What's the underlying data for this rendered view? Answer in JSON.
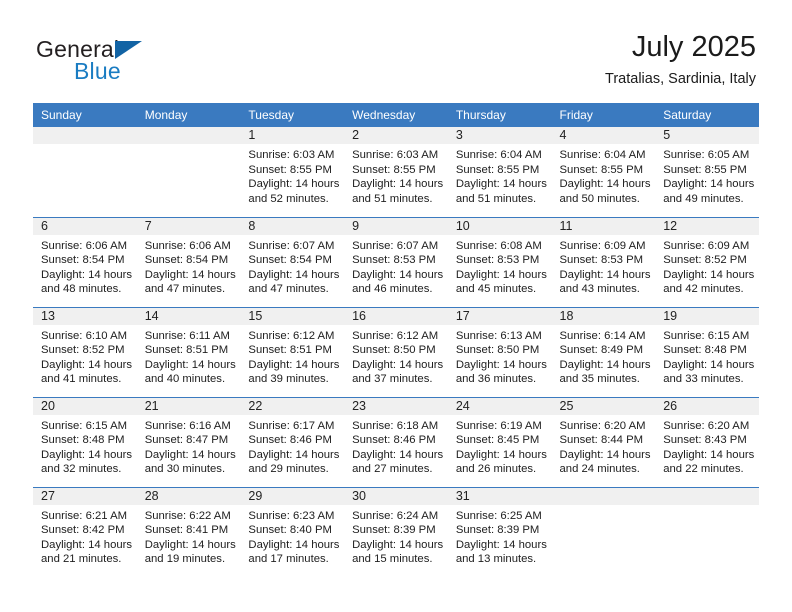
{
  "brand": {
    "name_part1": "General",
    "name_part2": "Blue",
    "logo_icon": "triangle-logo-icon"
  },
  "header": {
    "month_title": "July 2025",
    "location": "Tratalias, Sardinia, Italy"
  },
  "calendar": {
    "weekday_headers": [
      "Sunday",
      "Monday",
      "Tuesday",
      "Wednesday",
      "Thursday",
      "Friday",
      "Saturday"
    ],
    "colors": {
      "header_blue": "#3a7ac0",
      "daynum_band": "#f0f0f0",
      "brand_blue": "#1a7cc2",
      "logo_triangle": "#1263a4"
    },
    "weeks": [
      [
        {
          "day": "",
          "empty": true,
          "sunrise": "",
          "sunset": "",
          "daylight_l1": "",
          "daylight_l2": ""
        },
        {
          "day": "",
          "empty": true,
          "sunrise": "",
          "sunset": "",
          "daylight_l1": "",
          "daylight_l2": ""
        },
        {
          "day": "1",
          "empty": false,
          "sunrise": "Sunrise: 6:03 AM",
          "sunset": "Sunset: 8:55 PM",
          "daylight_l1": "Daylight: 14 hours",
          "daylight_l2": "and 52 minutes."
        },
        {
          "day": "2",
          "empty": false,
          "sunrise": "Sunrise: 6:03 AM",
          "sunset": "Sunset: 8:55 PM",
          "daylight_l1": "Daylight: 14 hours",
          "daylight_l2": "and 51 minutes."
        },
        {
          "day": "3",
          "empty": false,
          "sunrise": "Sunrise: 6:04 AM",
          "sunset": "Sunset: 8:55 PM",
          "daylight_l1": "Daylight: 14 hours",
          "daylight_l2": "and 51 minutes."
        },
        {
          "day": "4",
          "empty": false,
          "sunrise": "Sunrise: 6:04 AM",
          "sunset": "Sunset: 8:55 PM",
          "daylight_l1": "Daylight: 14 hours",
          "daylight_l2": "and 50 minutes."
        },
        {
          "day": "5",
          "empty": false,
          "sunrise": "Sunrise: 6:05 AM",
          "sunset": "Sunset: 8:55 PM",
          "daylight_l1": "Daylight: 14 hours",
          "daylight_l2": "and 49 minutes."
        }
      ],
      [
        {
          "day": "6",
          "empty": false,
          "sunrise": "Sunrise: 6:06 AM",
          "sunset": "Sunset: 8:54 PM",
          "daylight_l1": "Daylight: 14 hours",
          "daylight_l2": "and 48 minutes."
        },
        {
          "day": "7",
          "empty": false,
          "sunrise": "Sunrise: 6:06 AM",
          "sunset": "Sunset: 8:54 PM",
          "daylight_l1": "Daylight: 14 hours",
          "daylight_l2": "and 47 minutes."
        },
        {
          "day": "8",
          "empty": false,
          "sunrise": "Sunrise: 6:07 AM",
          "sunset": "Sunset: 8:54 PM",
          "daylight_l1": "Daylight: 14 hours",
          "daylight_l2": "and 47 minutes."
        },
        {
          "day": "9",
          "empty": false,
          "sunrise": "Sunrise: 6:07 AM",
          "sunset": "Sunset: 8:53 PM",
          "daylight_l1": "Daylight: 14 hours",
          "daylight_l2": "and 46 minutes."
        },
        {
          "day": "10",
          "empty": false,
          "sunrise": "Sunrise: 6:08 AM",
          "sunset": "Sunset: 8:53 PM",
          "daylight_l1": "Daylight: 14 hours",
          "daylight_l2": "and 45 minutes."
        },
        {
          "day": "11",
          "empty": false,
          "sunrise": "Sunrise: 6:09 AM",
          "sunset": "Sunset: 8:53 PM",
          "daylight_l1": "Daylight: 14 hours",
          "daylight_l2": "and 43 minutes."
        },
        {
          "day": "12",
          "empty": false,
          "sunrise": "Sunrise: 6:09 AM",
          "sunset": "Sunset: 8:52 PM",
          "daylight_l1": "Daylight: 14 hours",
          "daylight_l2": "and 42 minutes."
        }
      ],
      [
        {
          "day": "13",
          "empty": false,
          "sunrise": "Sunrise: 6:10 AM",
          "sunset": "Sunset: 8:52 PM",
          "daylight_l1": "Daylight: 14 hours",
          "daylight_l2": "and 41 minutes."
        },
        {
          "day": "14",
          "empty": false,
          "sunrise": "Sunrise: 6:11 AM",
          "sunset": "Sunset: 8:51 PM",
          "daylight_l1": "Daylight: 14 hours",
          "daylight_l2": "and 40 minutes."
        },
        {
          "day": "15",
          "empty": false,
          "sunrise": "Sunrise: 6:12 AM",
          "sunset": "Sunset: 8:51 PM",
          "daylight_l1": "Daylight: 14 hours",
          "daylight_l2": "and 39 minutes."
        },
        {
          "day": "16",
          "empty": false,
          "sunrise": "Sunrise: 6:12 AM",
          "sunset": "Sunset: 8:50 PM",
          "daylight_l1": "Daylight: 14 hours",
          "daylight_l2": "and 37 minutes."
        },
        {
          "day": "17",
          "empty": false,
          "sunrise": "Sunrise: 6:13 AM",
          "sunset": "Sunset: 8:50 PM",
          "daylight_l1": "Daylight: 14 hours",
          "daylight_l2": "and 36 minutes."
        },
        {
          "day": "18",
          "empty": false,
          "sunrise": "Sunrise: 6:14 AM",
          "sunset": "Sunset: 8:49 PM",
          "daylight_l1": "Daylight: 14 hours",
          "daylight_l2": "and 35 minutes."
        },
        {
          "day": "19",
          "empty": false,
          "sunrise": "Sunrise: 6:15 AM",
          "sunset": "Sunset: 8:48 PM",
          "daylight_l1": "Daylight: 14 hours",
          "daylight_l2": "and 33 minutes."
        }
      ],
      [
        {
          "day": "20",
          "empty": false,
          "sunrise": "Sunrise: 6:15 AM",
          "sunset": "Sunset: 8:48 PM",
          "daylight_l1": "Daylight: 14 hours",
          "daylight_l2": "and 32 minutes."
        },
        {
          "day": "21",
          "empty": false,
          "sunrise": "Sunrise: 6:16 AM",
          "sunset": "Sunset: 8:47 PM",
          "daylight_l1": "Daylight: 14 hours",
          "daylight_l2": "and 30 minutes."
        },
        {
          "day": "22",
          "empty": false,
          "sunrise": "Sunrise: 6:17 AM",
          "sunset": "Sunset: 8:46 PM",
          "daylight_l1": "Daylight: 14 hours",
          "daylight_l2": "and 29 minutes."
        },
        {
          "day": "23",
          "empty": false,
          "sunrise": "Sunrise: 6:18 AM",
          "sunset": "Sunset: 8:46 PM",
          "daylight_l1": "Daylight: 14 hours",
          "daylight_l2": "and 27 minutes."
        },
        {
          "day": "24",
          "empty": false,
          "sunrise": "Sunrise: 6:19 AM",
          "sunset": "Sunset: 8:45 PM",
          "daylight_l1": "Daylight: 14 hours",
          "daylight_l2": "and 26 minutes."
        },
        {
          "day": "25",
          "empty": false,
          "sunrise": "Sunrise: 6:20 AM",
          "sunset": "Sunset: 8:44 PM",
          "daylight_l1": "Daylight: 14 hours",
          "daylight_l2": "and 24 minutes."
        },
        {
          "day": "26",
          "empty": false,
          "sunrise": "Sunrise: 6:20 AM",
          "sunset": "Sunset: 8:43 PM",
          "daylight_l1": "Daylight: 14 hours",
          "daylight_l2": "and 22 minutes."
        }
      ],
      [
        {
          "day": "27",
          "empty": false,
          "sunrise": "Sunrise: 6:21 AM",
          "sunset": "Sunset: 8:42 PM",
          "daylight_l1": "Daylight: 14 hours",
          "daylight_l2": "and 21 minutes."
        },
        {
          "day": "28",
          "empty": false,
          "sunrise": "Sunrise: 6:22 AM",
          "sunset": "Sunset: 8:41 PM",
          "daylight_l1": "Daylight: 14 hours",
          "daylight_l2": "and 19 minutes."
        },
        {
          "day": "29",
          "empty": false,
          "sunrise": "Sunrise: 6:23 AM",
          "sunset": "Sunset: 8:40 PM",
          "daylight_l1": "Daylight: 14 hours",
          "daylight_l2": "and 17 minutes."
        },
        {
          "day": "30",
          "empty": false,
          "sunrise": "Sunrise: 6:24 AM",
          "sunset": "Sunset: 8:39 PM",
          "daylight_l1": "Daylight: 14 hours",
          "daylight_l2": "and 15 minutes."
        },
        {
          "day": "31",
          "empty": false,
          "sunrise": "Sunrise: 6:25 AM",
          "sunset": "Sunset: 8:39 PM",
          "daylight_l1": "Daylight: 14 hours",
          "daylight_l2": "and 13 minutes."
        },
        {
          "day": "",
          "empty": true,
          "sunrise": "",
          "sunset": "",
          "daylight_l1": "",
          "daylight_l2": ""
        },
        {
          "day": "",
          "empty": true,
          "sunrise": "",
          "sunset": "",
          "daylight_l1": "",
          "daylight_l2": ""
        }
      ]
    ]
  }
}
